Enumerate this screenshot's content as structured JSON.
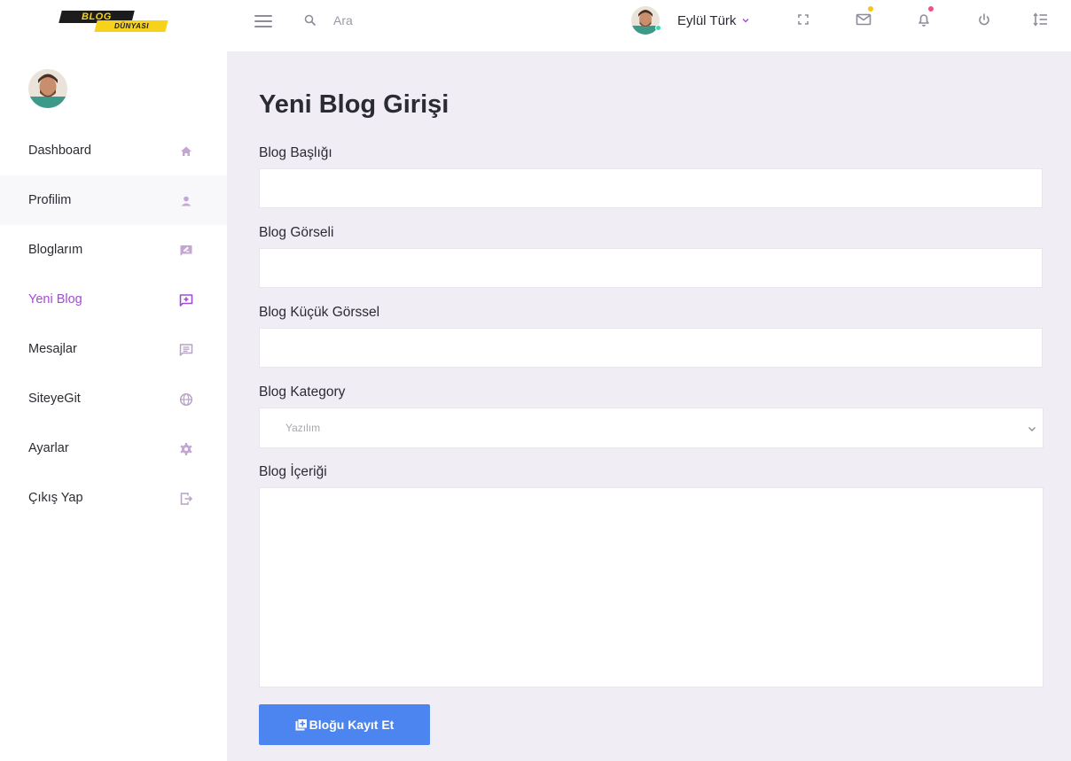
{
  "logo": {
    "line1": "BLOG",
    "line2": "DÜNYASI"
  },
  "search": {
    "placeholder": "Ara"
  },
  "user": {
    "name": "Eylül Türk"
  },
  "colors": {
    "accent_purple": "#a24bd6",
    "button_blue": "#4c85f0",
    "content_bg": "#f0edf4",
    "mail_badge": "#f5c518",
    "bell_badge": "#f0508a",
    "online_dot": "#38d9a9"
  },
  "top_icons": [
    "fullscreen-icon",
    "mail-icon",
    "bell-icon",
    "power-icon",
    "sort-list-icon"
  ],
  "sidebar": {
    "items": [
      {
        "label": "Dashboard",
        "icon": "home-icon"
      },
      {
        "label": "Profilim",
        "icon": "user-icon"
      },
      {
        "label": "Bloglarım",
        "icon": "edit-message-icon"
      },
      {
        "label": "Yeni Blog",
        "icon": "add-message-icon"
      },
      {
        "label": "Mesajlar",
        "icon": "chat-icon"
      },
      {
        "label": "SiteyeGit",
        "icon": "globe-icon"
      },
      {
        "label": "Ayarlar",
        "icon": "gear-icon"
      },
      {
        "label": "Çıkış Yap",
        "icon": "logout-icon"
      }
    ]
  },
  "form": {
    "title": "Yeni Blog Girişi",
    "title_label": "Blog Başlığı",
    "title_value": "",
    "image_label": "Blog Görseli",
    "image_value": "",
    "thumb_label": "Blog Küçük Görssel",
    "thumb_value": "",
    "category_label": "Blog Kategory",
    "category_selected": "Yazılım",
    "content_label": "Blog İçeriği",
    "content_value": "",
    "submit_label": "Bloğu Kayıt Et"
  }
}
